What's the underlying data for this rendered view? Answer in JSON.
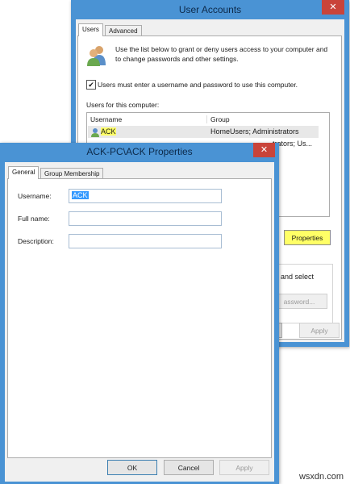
{
  "user_accounts": {
    "title": "User Accounts",
    "close": "✕",
    "tabs": [
      "Users",
      "Advanced"
    ],
    "intro_text": "Use the list below to grant or deny users access to your computer and to change passwords and other settings.",
    "checkbox_label": "Users must enter a username and password to use this computer.",
    "checkbox_checked": true,
    "users_label": "Users for this computer:",
    "columns": [
      "Username",
      "Group"
    ],
    "rows": [
      {
        "username": "ACK",
        "group": "HomeUsers; Administrators"
      },
      {
        "username": "",
        "group": "trators; Us..."
      }
    ],
    "properties_button": "Properties",
    "partial_text": "and select",
    "reset_password_button": "assword...",
    "ok_partial": "l",
    "apply_button": "Apply"
  },
  "properties_dialog": {
    "title": "ACK-PC\\ACK Properties",
    "close": "✕",
    "tabs": [
      "General",
      "Group Membership"
    ],
    "fields": {
      "username_label": "Username:",
      "username_value": "ACK",
      "fullname_label": "Full name:",
      "fullname_value": "",
      "description_label": "Description:",
      "description_value": ""
    },
    "ok_button": "OK",
    "cancel_button": "Cancel",
    "apply_button": "Apply"
  },
  "watermark": "wsxdn.com",
  "colors": {
    "frame": "#4a93d4",
    "close": "#c9443a",
    "highlight": "#ffff66",
    "selection": "#3399ff"
  }
}
